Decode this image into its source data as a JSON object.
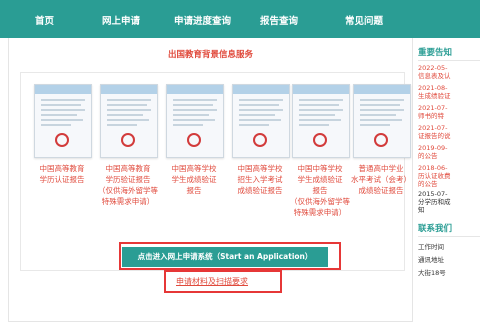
{
  "nav": {
    "items": [
      "首页",
      "网上申请",
      "申请进度查询",
      "报告查询",
      "常见问题"
    ]
  },
  "main": {
    "title": "出国教育背景信息服务",
    "cards": [
      {
        "label": [
          "中国高等教育",
          "学历认证报告"
        ]
      },
      {
        "label": [
          "中国高等教育",
          "学历验证报告",
          "（仅供海外留学等",
          "特殊需求申请）"
        ]
      },
      {
        "label": [
          "中国高等学校",
          "学生成绩验证",
          "报告"
        ]
      },
      {
        "label": [
          "中国高等学校",
          "招生入学考试",
          "成绩验证报告"
        ]
      },
      {
        "label": [
          "中国中等学校",
          "学生成绩验证",
          "报告",
          "（仅供海外留学等",
          "特殊需求申请）"
        ]
      },
      {
        "label": [
          "普通高中学业",
          "水平考试（会考）",
          "成绩验证报告"
        ]
      }
    ],
    "apply_button": "点击进入网上申请系统（Start an Application）",
    "requirements_link": "申请材料及扫描要求"
  },
  "sidebar": {
    "title": "重要告知",
    "news": [
      {
        "date": "2022-05-",
        "text": "信息表及认"
      },
      {
        "date": "2021-08-",
        "text": "生成绩验证"
      },
      {
        "date": "2021-07-",
        "text": "师书的特"
      },
      {
        "date": "2021-07-",
        "text": "证报告的说"
      },
      {
        "date": "2019-09-",
        "text": "的公告"
      },
      {
        "date": "2018-06-",
        "text": "历认证收费"
      },
      {
        "date": "",
        "text": "的公告"
      },
      {
        "date": "2015-07-",
        "text": "分学历和成"
      },
      {
        "date": "",
        "text": "知"
      }
    ],
    "contact_title": "联系我们",
    "contact": [
      "工作时间",
      "通讯地址",
      "大街18号"
    ]
  }
}
